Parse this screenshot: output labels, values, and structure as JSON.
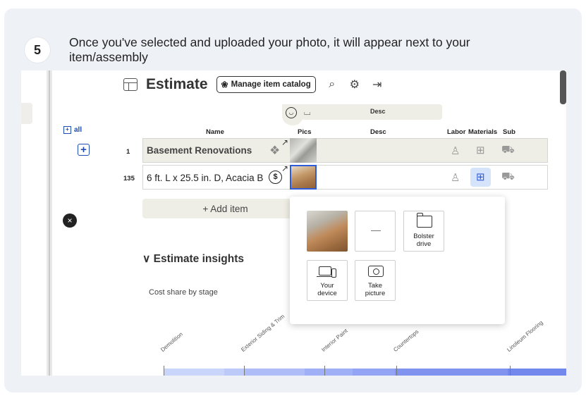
{
  "step": {
    "number": "5",
    "text": "Once you've selected and uploaded your photo, it will appear next to your item/assembly"
  },
  "toolbar": {
    "title": "Estimate",
    "manage_label": "Manage item catalog",
    "icons": [
      "grid-icon",
      "catalog-icon",
      "search-icon",
      "gear-icon",
      "export-icon"
    ]
  },
  "floating_header": {
    "desc_label": "Desc"
  },
  "table": {
    "all_label": "all",
    "columns": {
      "name": "Name",
      "pics": "Pics",
      "desc": "Desc",
      "labor": "Labor",
      "materials": "Materials",
      "sub": "Sub"
    },
    "rows": [
      {
        "num": "1",
        "name": "Basement Renovations",
        "kind": "assembly"
      },
      {
        "num": "135",
        "name": "6 ft. L x 25.5 in. D, Acacia B",
        "kind": "item"
      }
    ],
    "add_item_label": "+ Add item"
  },
  "insights": {
    "heading": "Estimate insights",
    "cost_share_label": "Cost share by stage",
    "stages": [
      "Demolition",
      "Exterior Siding & Trim",
      "Interior Paint",
      "Countertops",
      "Linoleum Flooring"
    ]
  },
  "upload_popup": {
    "close_glyph": "×",
    "empty_tile_glyph": "—",
    "tiles": {
      "bolster": "Bolster\ndrive",
      "device": "Your\ndevice",
      "picture": "Take\npicture"
    }
  },
  "colors": {
    "accent_blue": "#2e5bd7",
    "link_blue": "#1f4cb0",
    "row_beige": "#efeee6",
    "card_bg": "#eef1f6"
  }
}
